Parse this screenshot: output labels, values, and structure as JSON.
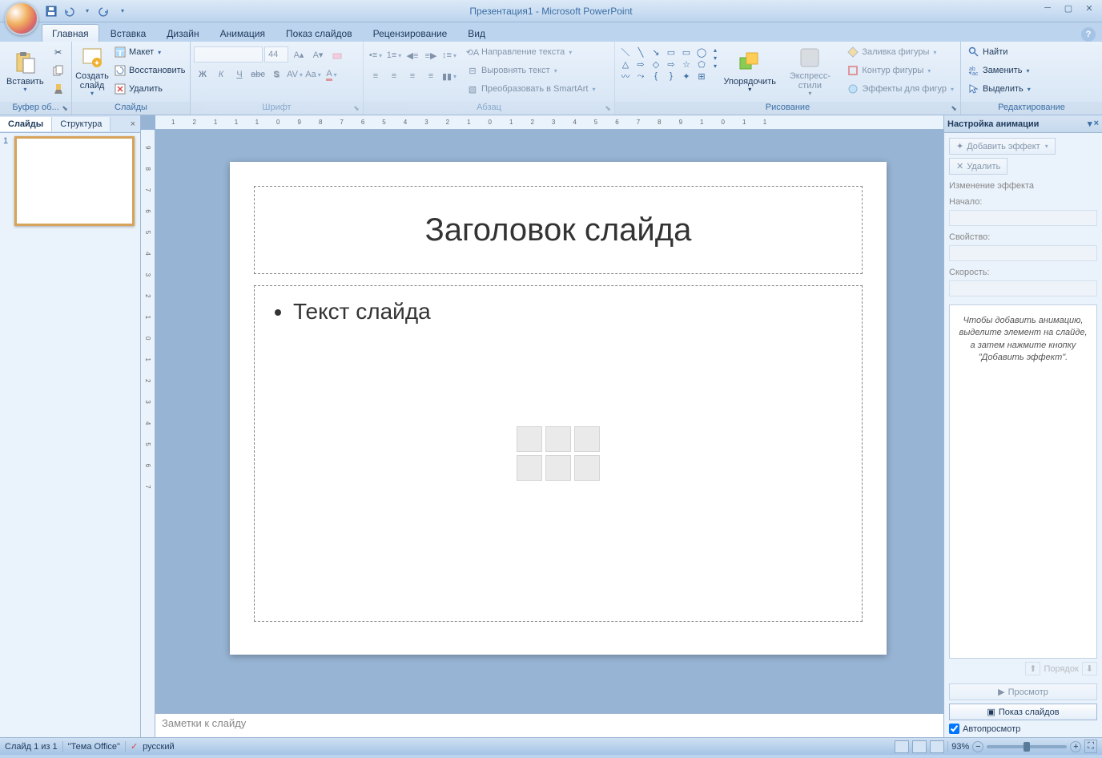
{
  "title": "Презентация1 - Microsoft PowerPoint",
  "tabs": [
    "Главная",
    "Вставка",
    "Дизайн",
    "Анимация",
    "Показ слайдов",
    "Рецензирование",
    "Вид"
  ],
  "ribbon": {
    "clipboard": {
      "label": "Буфер об...",
      "paste": "Вставить"
    },
    "slides": {
      "label": "Слайды",
      "new": "Создать слайд",
      "layout": "Макет",
      "reset": "Восстановить",
      "delete": "Удалить"
    },
    "font": {
      "label": "Шрифт",
      "size": "44"
    },
    "paragraph": {
      "label": "Абзац",
      "dir": "Направление текста",
      "align": "Выровнять текст",
      "smartart": "Преобразовать в SmartArt"
    },
    "drawing": {
      "label": "Рисование",
      "arrange": "Упорядочить",
      "styles": "Экспресс-стили",
      "fill": "Заливка фигуры",
      "outline": "Контур фигуры",
      "effects": "Эффекты для фигур"
    },
    "editing": {
      "label": "Редактирование",
      "find": "Найти",
      "replace": "Заменить",
      "select": "Выделить"
    }
  },
  "left_panel": {
    "tab_slides": "Слайды",
    "tab_outline": "Структура",
    "slide_num": "1"
  },
  "slide": {
    "title": "Заголовок слайда",
    "text": "Текст слайда"
  },
  "notes_placeholder": "Заметки к слайду",
  "anim_pane": {
    "title": "Настройка анимации",
    "add_effect": "Добавить эффект",
    "remove": "Удалить",
    "change_label": "Изменение эффекта",
    "start": "Начало:",
    "property": "Свойство:",
    "speed": "Скорость:",
    "hint": "Чтобы добавить анимацию, выделите элемент на слайде, а затем нажмите кнопку \"Добавить эффект\".",
    "order": "Порядок",
    "preview": "Просмотр",
    "slideshow": "Показ слайдов",
    "autoplay": "Автопросмотр"
  },
  "statusbar": {
    "slide": "Слайд 1 из 1",
    "theme": "\"Тема Office\"",
    "lang": "русский",
    "zoom": "93%"
  }
}
